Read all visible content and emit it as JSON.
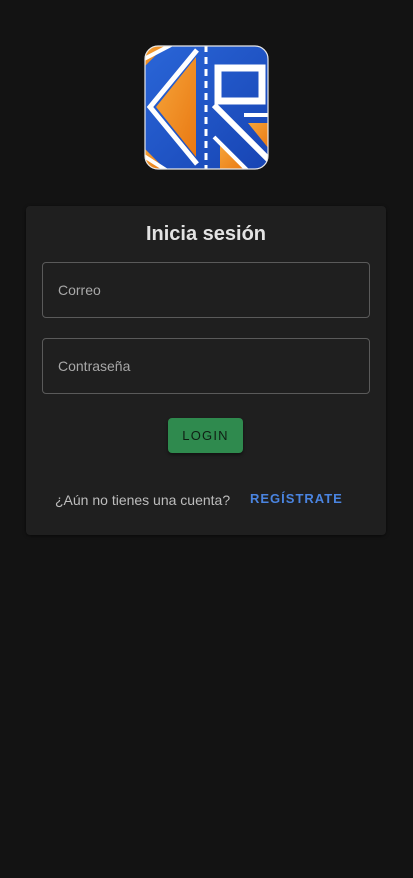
{
  "logo": {
    "icon": "app-logo-icon",
    "colors": {
      "blue": "#1f56c8",
      "orange": "#f08a1a",
      "white": "#ffffff"
    }
  },
  "login": {
    "title": "Inicia sesión",
    "email_placeholder": "Correo",
    "password_placeholder": "Contraseña",
    "login_label": "LOGIN",
    "no_account_text": "¿Aún no tienes una cuenta?",
    "signup_label": "REGÍSTRATE"
  },
  "theme": {
    "background": "#131313",
    "card": "#1f1f1f",
    "primary_button": "#2f8a4e",
    "link": "#4a84e0"
  }
}
